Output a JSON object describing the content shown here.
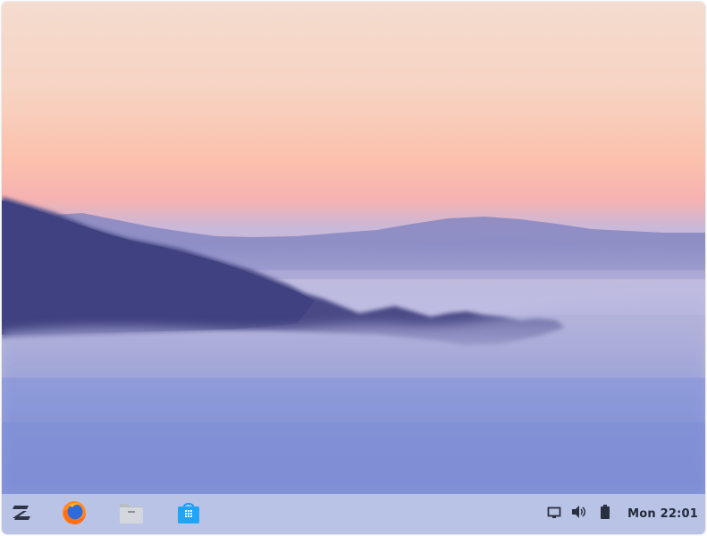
{
  "desktop": {
    "wallpaper_name": "foggy-hills-sunrise"
  },
  "taskbar": {
    "background": "#b9c3e6",
    "launcher": {
      "icon": "zorin-menu-icon"
    },
    "pinned_apps": [
      {
        "icon": "firefox-icon"
      },
      {
        "icon": "files-folder-icon"
      },
      {
        "icon": "software-store-icon"
      }
    ],
    "tray": [
      {
        "icon": "display-icon"
      },
      {
        "icon": "volume-icon"
      },
      {
        "icon": "battery-icon"
      }
    ],
    "clock": "Mon 22:01"
  }
}
